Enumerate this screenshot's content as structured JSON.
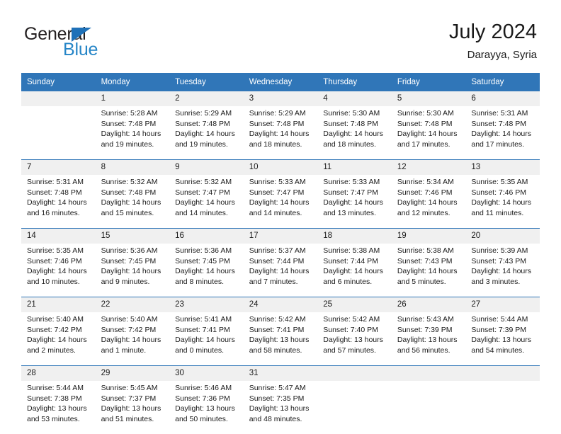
{
  "brand": {
    "name_part1": "General",
    "name_part2": "Blue",
    "triangle_color": "#1f71b8",
    "blue_text_color": "#2585c7"
  },
  "header": {
    "title": "July 2024",
    "subtitle": "Darayya, Syria"
  },
  "theme": {
    "header_bg": "#3076b8",
    "daynum_bg": "#f0f0f0",
    "cell_bg": "#ffffff",
    "text": "#1a1a1a"
  },
  "weekdays": [
    "Sunday",
    "Monday",
    "Tuesday",
    "Wednesday",
    "Thursday",
    "Friday",
    "Saturday"
  ],
  "weeks": [
    [
      {
        "day": "",
        "sunrise": "",
        "sunset": "",
        "daylight_a": "",
        "daylight_b": ""
      },
      {
        "day": "1",
        "sunrise": "Sunrise: 5:28 AM",
        "sunset": "Sunset: 7:48 PM",
        "daylight_a": "Daylight: 14 hours",
        "daylight_b": "and 19 minutes."
      },
      {
        "day": "2",
        "sunrise": "Sunrise: 5:29 AM",
        "sunset": "Sunset: 7:48 PM",
        "daylight_a": "Daylight: 14 hours",
        "daylight_b": "and 19 minutes."
      },
      {
        "day": "3",
        "sunrise": "Sunrise: 5:29 AM",
        "sunset": "Sunset: 7:48 PM",
        "daylight_a": "Daylight: 14 hours",
        "daylight_b": "and 18 minutes."
      },
      {
        "day": "4",
        "sunrise": "Sunrise: 5:30 AM",
        "sunset": "Sunset: 7:48 PM",
        "daylight_a": "Daylight: 14 hours",
        "daylight_b": "and 18 minutes."
      },
      {
        "day": "5",
        "sunrise": "Sunrise: 5:30 AM",
        "sunset": "Sunset: 7:48 PM",
        "daylight_a": "Daylight: 14 hours",
        "daylight_b": "and 17 minutes."
      },
      {
        "day": "6",
        "sunrise": "Sunrise: 5:31 AM",
        "sunset": "Sunset: 7:48 PM",
        "daylight_a": "Daylight: 14 hours",
        "daylight_b": "and 17 minutes."
      }
    ],
    [
      {
        "day": "7",
        "sunrise": "Sunrise: 5:31 AM",
        "sunset": "Sunset: 7:48 PM",
        "daylight_a": "Daylight: 14 hours",
        "daylight_b": "and 16 minutes."
      },
      {
        "day": "8",
        "sunrise": "Sunrise: 5:32 AM",
        "sunset": "Sunset: 7:48 PM",
        "daylight_a": "Daylight: 14 hours",
        "daylight_b": "and 15 minutes."
      },
      {
        "day": "9",
        "sunrise": "Sunrise: 5:32 AM",
        "sunset": "Sunset: 7:47 PM",
        "daylight_a": "Daylight: 14 hours",
        "daylight_b": "and 14 minutes."
      },
      {
        "day": "10",
        "sunrise": "Sunrise: 5:33 AM",
        "sunset": "Sunset: 7:47 PM",
        "daylight_a": "Daylight: 14 hours",
        "daylight_b": "and 14 minutes."
      },
      {
        "day": "11",
        "sunrise": "Sunrise: 5:33 AM",
        "sunset": "Sunset: 7:47 PM",
        "daylight_a": "Daylight: 14 hours",
        "daylight_b": "and 13 minutes."
      },
      {
        "day": "12",
        "sunrise": "Sunrise: 5:34 AM",
        "sunset": "Sunset: 7:46 PM",
        "daylight_a": "Daylight: 14 hours",
        "daylight_b": "and 12 minutes."
      },
      {
        "day": "13",
        "sunrise": "Sunrise: 5:35 AM",
        "sunset": "Sunset: 7:46 PM",
        "daylight_a": "Daylight: 14 hours",
        "daylight_b": "and 11 minutes."
      }
    ],
    [
      {
        "day": "14",
        "sunrise": "Sunrise: 5:35 AM",
        "sunset": "Sunset: 7:46 PM",
        "daylight_a": "Daylight: 14 hours",
        "daylight_b": "and 10 minutes."
      },
      {
        "day": "15",
        "sunrise": "Sunrise: 5:36 AM",
        "sunset": "Sunset: 7:45 PM",
        "daylight_a": "Daylight: 14 hours",
        "daylight_b": "and 9 minutes."
      },
      {
        "day": "16",
        "sunrise": "Sunrise: 5:36 AM",
        "sunset": "Sunset: 7:45 PM",
        "daylight_a": "Daylight: 14 hours",
        "daylight_b": "and 8 minutes."
      },
      {
        "day": "17",
        "sunrise": "Sunrise: 5:37 AM",
        "sunset": "Sunset: 7:44 PM",
        "daylight_a": "Daylight: 14 hours",
        "daylight_b": "and 7 minutes."
      },
      {
        "day": "18",
        "sunrise": "Sunrise: 5:38 AM",
        "sunset": "Sunset: 7:44 PM",
        "daylight_a": "Daylight: 14 hours",
        "daylight_b": "and 6 minutes."
      },
      {
        "day": "19",
        "sunrise": "Sunrise: 5:38 AM",
        "sunset": "Sunset: 7:43 PM",
        "daylight_a": "Daylight: 14 hours",
        "daylight_b": "and 5 minutes."
      },
      {
        "day": "20",
        "sunrise": "Sunrise: 5:39 AM",
        "sunset": "Sunset: 7:43 PM",
        "daylight_a": "Daylight: 14 hours",
        "daylight_b": "and 3 minutes."
      }
    ],
    [
      {
        "day": "21",
        "sunrise": "Sunrise: 5:40 AM",
        "sunset": "Sunset: 7:42 PM",
        "daylight_a": "Daylight: 14 hours",
        "daylight_b": "and 2 minutes."
      },
      {
        "day": "22",
        "sunrise": "Sunrise: 5:40 AM",
        "sunset": "Sunset: 7:42 PM",
        "daylight_a": "Daylight: 14 hours",
        "daylight_b": "and 1 minute."
      },
      {
        "day": "23",
        "sunrise": "Sunrise: 5:41 AM",
        "sunset": "Sunset: 7:41 PM",
        "daylight_a": "Daylight: 14 hours",
        "daylight_b": "and 0 minutes."
      },
      {
        "day": "24",
        "sunrise": "Sunrise: 5:42 AM",
        "sunset": "Sunset: 7:41 PM",
        "daylight_a": "Daylight: 13 hours",
        "daylight_b": "and 58 minutes."
      },
      {
        "day": "25",
        "sunrise": "Sunrise: 5:42 AM",
        "sunset": "Sunset: 7:40 PM",
        "daylight_a": "Daylight: 13 hours",
        "daylight_b": "and 57 minutes."
      },
      {
        "day": "26",
        "sunrise": "Sunrise: 5:43 AM",
        "sunset": "Sunset: 7:39 PM",
        "daylight_a": "Daylight: 13 hours",
        "daylight_b": "and 56 minutes."
      },
      {
        "day": "27",
        "sunrise": "Sunrise: 5:44 AM",
        "sunset": "Sunset: 7:39 PM",
        "daylight_a": "Daylight: 13 hours",
        "daylight_b": "and 54 minutes."
      }
    ],
    [
      {
        "day": "28",
        "sunrise": "Sunrise: 5:44 AM",
        "sunset": "Sunset: 7:38 PM",
        "daylight_a": "Daylight: 13 hours",
        "daylight_b": "and 53 minutes."
      },
      {
        "day": "29",
        "sunrise": "Sunrise: 5:45 AM",
        "sunset": "Sunset: 7:37 PM",
        "daylight_a": "Daylight: 13 hours",
        "daylight_b": "and 51 minutes."
      },
      {
        "day": "30",
        "sunrise": "Sunrise: 5:46 AM",
        "sunset": "Sunset: 7:36 PM",
        "daylight_a": "Daylight: 13 hours",
        "daylight_b": "and 50 minutes."
      },
      {
        "day": "31",
        "sunrise": "Sunrise: 5:47 AM",
        "sunset": "Sunset: 7:35 PM",
        "daylight_a": "Daylight: 13 hours",
        "daylight_b": "and 48 minutes."
      },
      {
        "day": "",
        "sunrise": "",
        "sunset": "",
        "daylight_a": "",
        "daylight_b": ""
      },
      {
        "day": "",
        "sunrise": "",
        "sunset": "",
        "daylight_a": "",
        "daylight_b": ""
      },
      {
        "day": "",
        "sunrise": "",
        "sunset": "",
        "daylight_a": "",
        "daylight_b": ""
      }
    ]
  ]
}
